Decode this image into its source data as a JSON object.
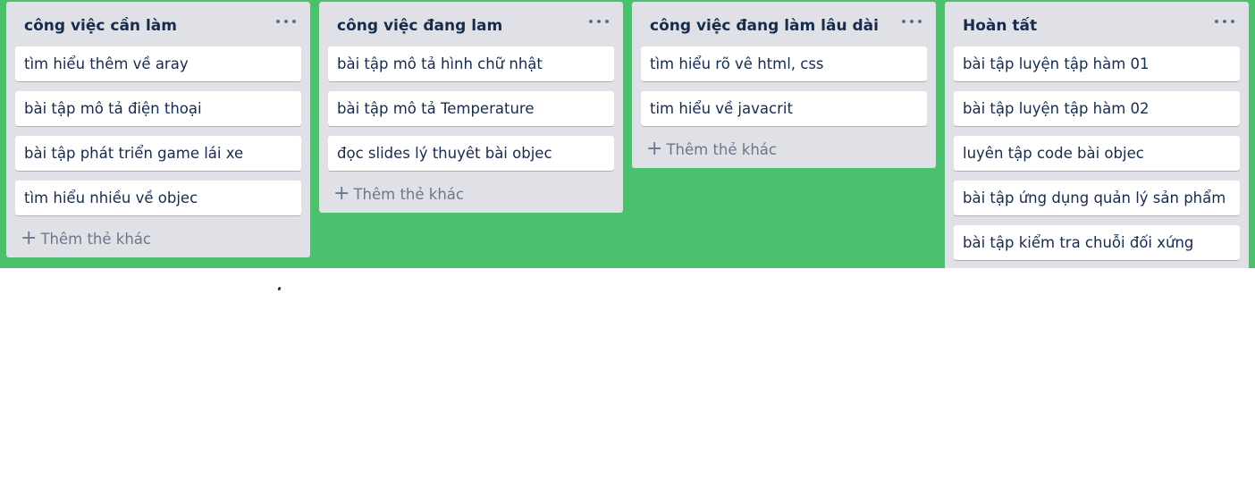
{
  "board": {
    "background_color": "#4bc16d",
    "lists": [
      {
        "title": "công việc cần làm",
        "menu_icon": "more-horizontal-icon",
        "cards": [
          "tìm hiểu thêm về aray",
          "bài tập mô tả điện thoại",
          "bài tập phát triển game lái xe",
          "tìm hiểu nhiều về objec"
        ],
        "add_label": "Thêm thẻ khác"
      },
      {
        "title": "công việc đang lam",
        "menu_icon": "more-horizontal-icon",
        "cards": [
          "bài tập mô tả hình chữ nhật",
          "bài tập mô tả Temperature",
          "đọc slides lý thuyêt bài objec"
        ],
        "add_label": "Thêm thẻ khác"
      },
      {
        "title": "công việc đang làm lâu dài",
        "menu_icon": "more-horizontal-icon",
        "cards": [
          "tìm hiểu rõ vê html, css",
          "tim hiểu về javacrit"
        ],
        "add_label": "Thêm thẻ khác"
      },
      {
        "title": "Hoàn tất",
        "menu_icon": "more-horizontal-icon",
        "cards": [
          "bài tập luyện tập hàm 01",
          "bài tập luyện tập hàm 02",
          "luyên tập code bài objec",
          "bài tập ứng dụng quản lý sản phẩm",
          "bài tập kiểm tra chuỗi đối xứng"
        ],
        "add_label": ""
      }
    ]
  }
}
